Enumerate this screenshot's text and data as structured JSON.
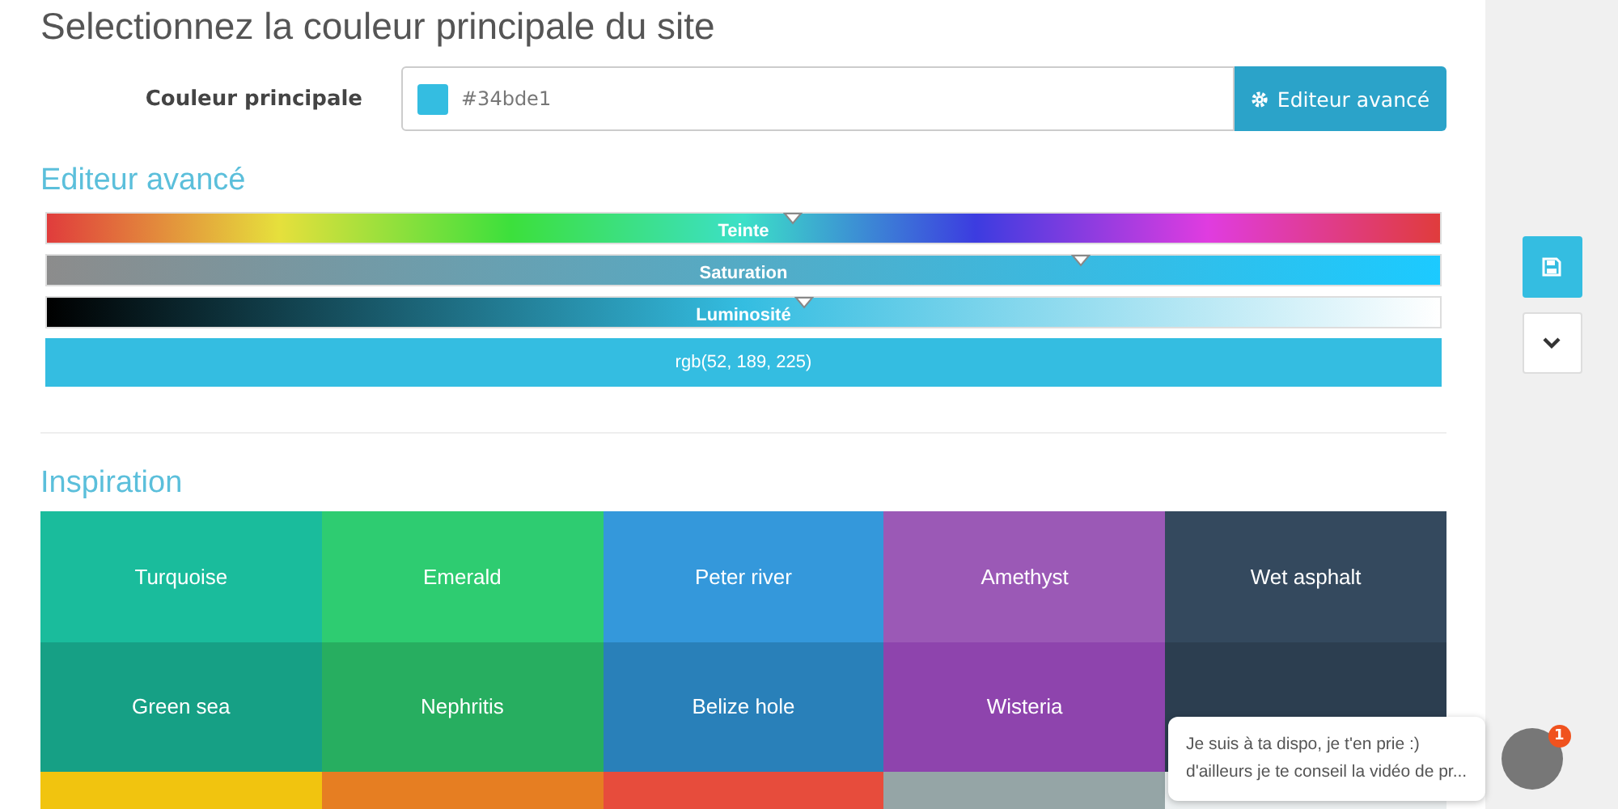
{
  "title": "Selectionnez la couleur principale du site",
  "main_color": {
    "label": "Couleur principale",
    "value": "#34bde1",
    "button": "Editeur avancé"
  },
  "editor": {
    "heading": "Editeur avancé",
    "sliders": [
      {
        "kind": "hue",
        "label": "Teinte",
        "level": 0.535
      },
      {
        "kind": "saturation",
        "label": "Saturation",
        "level": 0.742
      },
      {
        "kind": "luminosity",
        "label": "Luminosité",
        "level": 0.543
      }
    ],
    "result": "rgb(52, 189, 225)"
  },
  "inspiration": {
    "heading": "Inspiration",
    "tiles": [
      {
        "label": "Turquoise",
        "color": "#1abc9c"
      },
      {
        "label": "Emerald",
        "color": "#2ecc71"
      },
      {
        "label": "Peter river",
        "color": "#3498db"
      },
      {
        "label": "Amethyst",
        "color": "#9b59b6"
      },
      {
        "label": "Wet asphalt",
        "color": "#34495e"
      },
      {
        "label": "Green sea",
        "color": "#16a085"
      },
      {
        "label": "Nephritis",
        "color": "#27ae60"
      },
      {
        "label": "Belize hole",
        "color": "#2980b9"
      },
      {
        "label": "Wisteria",
        "color": "#8e44ad"
      },
      {
        "color": "#2c3e50"
      },
      {
        "color": "#f1c40f"
      },
      {
        "color": "#e67e22"
      },
      {
        "color": "#e74c3c"
      },
      {
        "color": "#95a5a6"
      },
      {
        "color": "#ecf0f1"
      }
    ]
  },
  "chat": {
    "message_lines": [
      "Je suis à ta dispo, je t'en prie :)",
      "d'ailleurs je te conseil la vidéo de pr..."
    ],
    "badge": "1"
  }
}
